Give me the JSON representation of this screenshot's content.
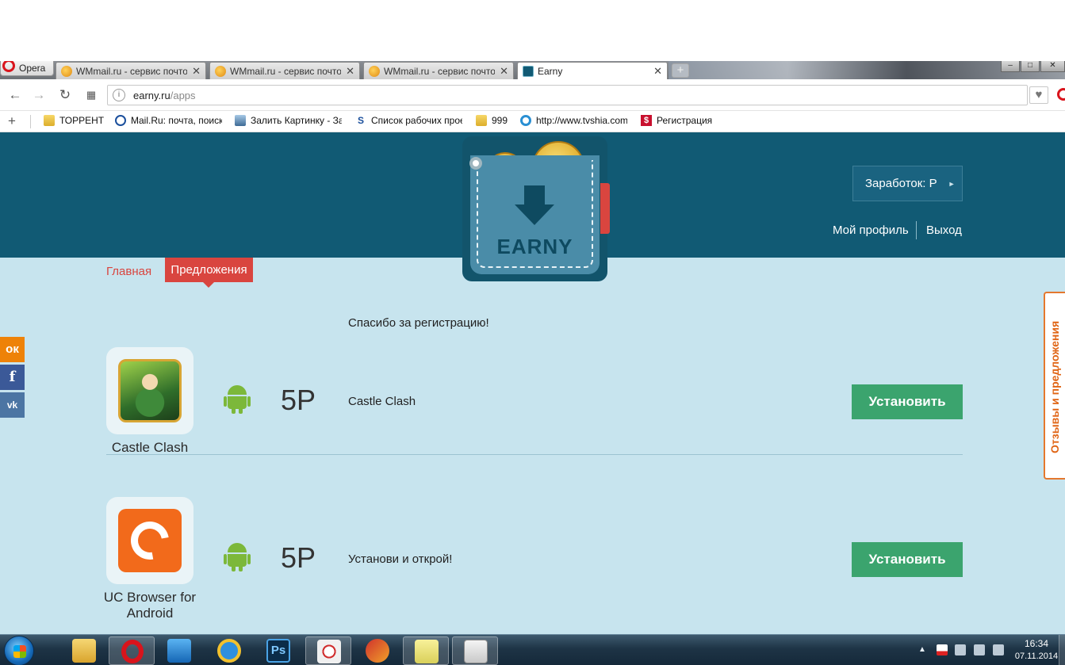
{
  "browser": {
    "app_name": "Opera",
    "tabs": [
      {
        "title": "WMmail.ru - сервис почтовых рассылок",
        "active": false
      },
      {
        "title": "WMmail.ru - сервис почтовых рассылок",
        "active": false
      },
      {
        "title": "WMmail.ru - сервис почтовых рассылок",
        "active": false
      },
      {
        "title": "Earny",
        "active": true
      }
    ],
    "tab_close": "✕",
    "new_tab": "+",
    "url": {
      "host": "earny.ru",
      "path": "/apps"
    },
    "bookmarks": [
      {
        "label": "ТОРРЕНТ",
        "icon": "folder-icon"
      },
      {
        "label": "Mail.Ru: почта, поиск в интернете",
        "icon": "mailru-icon"
      },
      {
        "label": "Залить Картинку - Загрузить",
        "icon": "image-icon"
      },
      {
        "label": "Список рабочих проектов",
        "icon": "sc-icon"
      },
      {
        "label": "999",
        "icon": "folder-icon"
      },
      {
        "label": "http://www.tvshia.com",
        "icon": "globe-icon"
      },
      {
        "label": "Регистрация",
        "icon": "dollar-icon"
      }
    ],
    "bookmark_add": "+"
  },
  "site": {
    "logo_text": "EARNY",
    "earnings_label": "Заработок: Р",
    "profile_link": "Мой профиль",
    "logout_link": "Выход",
    "nav": {
      "home": "Главная",
      "offers": "Предложения"
    },
    "thanks": "Спасибо за регистрацию!",
    "apps": [
      {
        "name": "Castle Clash",
        "reward": "5Р",
        "description": "Castle Clash",
        "install": "Установить",
        "platform": "android"
      },
      {
        "name": "UC Browser for Android",
        "reward": "5Р",
        "description": "Установи и открой!",
        "install": "Установить",
        "platform": "android"
      }
    ],
    "social": {
      "ok": "ок",
      "fb": "f",
      "vk": "vk"
    },
    "feedback": "Отзывы и предложения"
  },
  "taskbar": {
    "time": "16:34",
    "date": "07.11.2014",
    "active_app": "opera"
  },
  "colors": {
    "header_bg": "#115a74",
    "page_bg": "#c7e4ee",
    "accent_red": "#d9453f",
    "install_green": "#3ba46e",
    "android_green": "#7cb83a",
    "feedback_orange": "#e06414"
  }
}
